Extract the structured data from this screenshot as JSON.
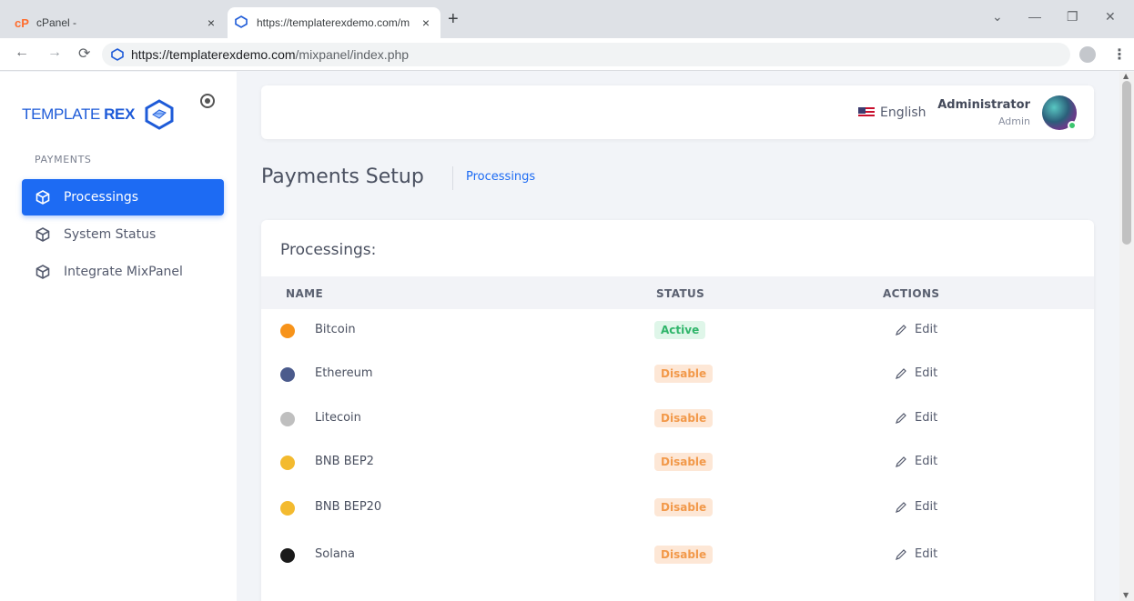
{
  "browser": {
    "tabs": [
      {
        "title": "cPanel -",
        "favicon": "cpanel-logo"
      },
      {
        "title": "https://templaterexdemo.com/m",
        "favicon": "template-rex-logo"
      }
    ],
    "new_tab_label": "+",
    "close_label": "×",
    "url_host": "https://templaterexdemo.com",
    "url_path": "/mixpanel/index.php",
    "window_controls": {
      "minimize": "—",
      "restore": "❐",
      "close": "✕",
      "dropdown": "⌄"
    }
  },
  "sidebar": {
    "brand": {
      "part1": "TEMPLATE",
      "part2": "REX"
    },
    "section_label": "PAYMENTS",
    "items": [
      {
        "label": "Processings",
        "icon": "cube-icon",
        "active": true
      },
      {
        "label": "System Status",
        "icon": "cube-icon",
        "active": false
      },
      {
        "label": "Integrate MixPanel",
        "icon": "cube-icon",
        "active": false
      }
    ]
  },
  "header": {
    "language": "English",
    "user_name": "Administrator",
    "user_role": "Admin"
  },
  "page": {
    "title": "Payments Setup",
    "breadcrumb": "Processings"
  },
  "table": {
    "title": "Processings:",
    "columns": [
      "NAME",
      "STATUS",
      "ACTIONS"
    ],
    "edit_label": "Edit",
    "rows": [
      {
        "name": "Bitcoin",
        "status": "Active",
        "coin_color": "#f7931a"
      },
      {
        "name": "Ethereum",
        "status": "Disable",
        "coin_color": "#4b5b8c"
      },
      {
        "name": "Litecoin",
        "status": "Disable",
        "coin_color": "#bfbfbf"
      },
      {
        "name": "BNB BEP2",
        "status": "Disable",
        "coin_color": "#f3ba2f"
      },
      {
        "name": "BNB BEP20",
        "status": "Disable",
        "coin_color": "#f3ba2f"
      },
      {
        "name": "Solana",
        "status": "Disable",
        "coin_color": "#1a1a1a"
      }
    ]
  },
  "colors": {
    "accent": "#1d6bf3",
    "active_badge": "#2fb56a",
    "disable_badge": "#f2994a"
  }
}
